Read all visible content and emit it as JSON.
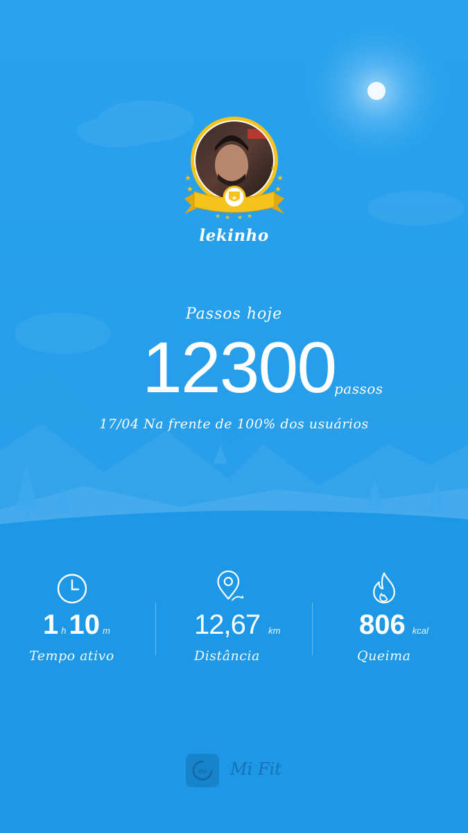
{
  "user": {
    "name": "lekinho"
  },
  "steps": {
    "title": "Passos hoje",
    "value": "12300",
    "unit": "passos",
    "rank_text": "17/04 Na frente de 100% dos usuários"
  },
  "stats": {
    "active_time": {
      "hours": "1",
      "hours_unit": "h",
      "minutes": "10",
      "minutes_unit": "m",
      "label": "Tempo ativo",
      "icon": "clock-icon"
    },
    "distance": {
      "value": "12,67",
      "unit": "km",
      "label": "Distância",
      "icon": "location-pin-icon"
    },
    "burn": {
      "value": "806",
      "unit": "kcal",
      "label": "Queima",
      "icon": "flame-icon"
    }
  },
  "app": {
    "brand_name": "Mi Fit",
    "logo_text": "mi"
  },
  "colors": {
    "background": "#1f9be8",
    "badge_gold": "#f6c21c",
    "text": "#ffffff"
  }
}
